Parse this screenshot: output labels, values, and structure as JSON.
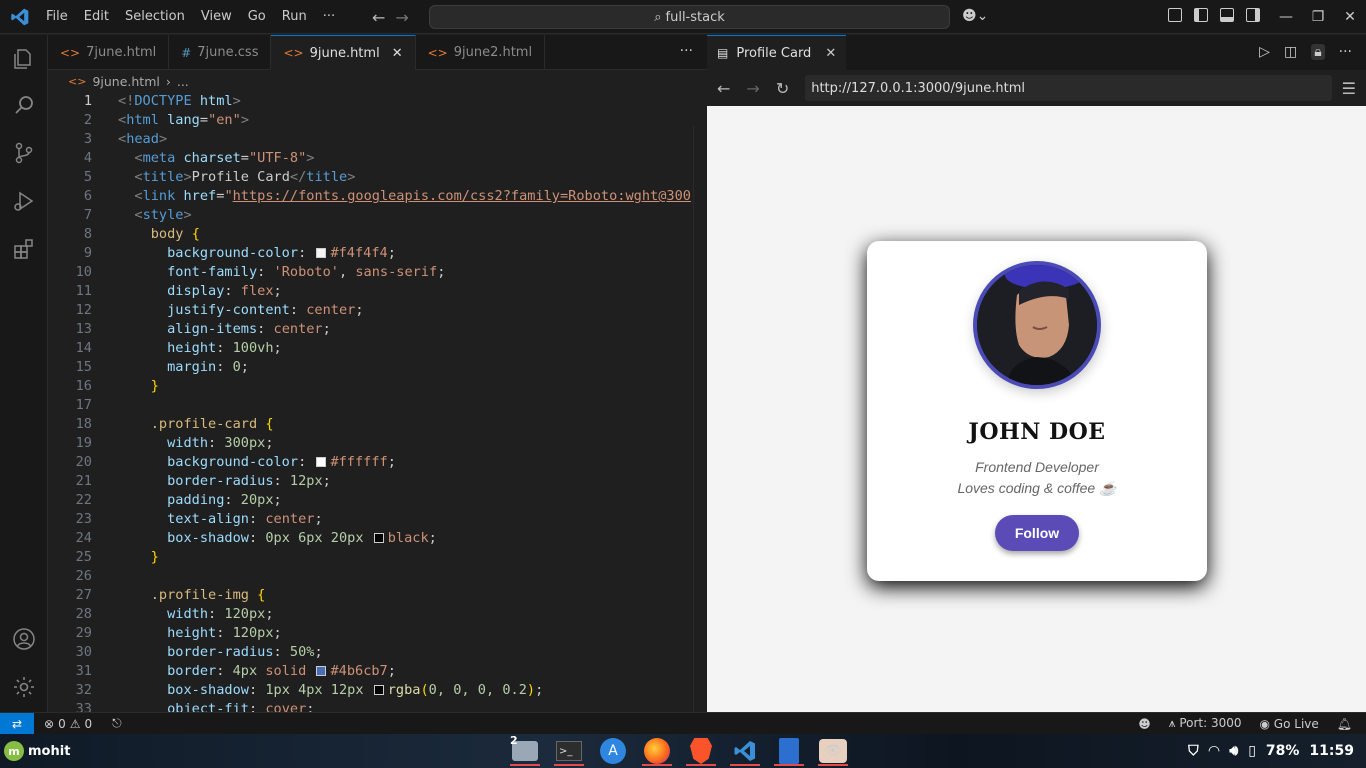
{
  "titlebar": {
    "menu": [
      "File",
      "Edit",
      "Selection",
      "View",
      "Go",
      "Run",
      "···"
    ],
    "search": "full-stack"
  },
  "editor": {
    "tabs": [
      {
        "label": "7june.html",
        "type": "html"
      },
      {
        "label": "7june.css",
        "type": "css"
      },
      {
        "label": "9june.html",
        "type": "html",
        "active": true
      },
      {
        "label": "9june2.html",
        "type": "html"
      }
    ],
    "breadcrumb": {
      "file": "9june.html",
      "rest": "..."
    },
    "lines": [
      {
        "n": "1",
        "html": "<span class='t-br'>&lt;!</span><span class='t-tag'>DOCTYPE</span> <span class='t-at'>html</span><span class='t-br'>&gt;</span>"
      },
      {
        "n": "2",
        "html": "<span class='t-br'>&lt;</span><span class='t-tag'>html</span> <span class='t-at'>lang</span>=<span class='t-st'>\"en\"</span><span class='t-br'>&gt;</span>"
      },
      {
        "n": "3",
        "html": "<span class='t-br'>&lt;</span><span class='t-tag'>head</span><span class='t-br'>&gt;</span>"
      },
      {
        "n": "4",
        "html": "  <span class='t-br'>&lt;</span><span class='t-tag'>meta</span> <span class='t-at'>charset</span>=<span class='t-st'>\"UTF-8\"</span><span class='t-br'>&gt;</span>"
      },
      {
        "n": "5",
        "html": "  <span class='t-br'>&lt;</span><span class='t-tag'>title</span><span class='t-br'>&gt;</span>Profile Card<span class='t-br'>&lt;/</span><span class='t-tag'>title</span><span class='t-br'>&gt;</span>"
      },
      {
        "n": "6",
        "html": "  <span class='t-br'>&lt;</span><span class='t-tag'>link</span> <span class='t-at'>href</span>=<span class='t-st'>\"</span><span class='t-url'>https://fonts.googleapis.com/css2?family=Roboto:wght@300</span>"
      },
      {
        "n": "7",
        "html": "  <span class='t-br'>&lt;</span><span class='t-tag'>style</span><span class='t-br'>&gt;</span>"
      },
      {
        "n": "8",
        "html": "    <span class='t-sel'>body</span> <span class='t-brace'>{</span>"
      },
      {
        "n": "9",
        "html": "      <span class='t-pr'>background-color</span>: <i class='sw' style='background:#f4f4f4'></i><span class='t-val'>#f4f4f4</span>;"
      },
      {
        "n": "10",
        "html": "      <span class='t-pr'>font-family</span>: <span class='t-st'>'Roboto'</span>, <span class='t-val'>sans-serif</span>;"
      },
      {
        "n": "11",
        "html": "      <span class='t-pr'>display</span>: <span class='t-val'>flex</span>;"
      },
      {
        "n": "12",
        "html": "      <span class='t-pr'>justify-content</span>: <span class='t-val'>center</span>;"
      },
      {
        "n": "13",
        "html": "      <span class='t-pr'>align-items</span>: <span class='t-val'>center</span>;"
      },
      {
        "n": "14",
        "html": "      <span class='t-pr'>height</span>: <span class='t-num'>100vh</span>;"
      },
      {
        "n": "15",
        "html": "      <span class='t-pr'>margin</span>: <span class='t-num'>0</span>;"
      },
      {
        "n": "16",
        "html": "    <span class='t-brace'>}</span>"
      },
      {
        "n": "17",
        "html": ""
      },
      {
        "n": "18",
        "html": "    <span class='t-sel'>.profile-card</span> <span class='t-brace'>{</span>"
      },
      {
        "n": "19",
        "html": "      <span class='t-pr'>width</span>: <span class='t-num'>300px</span>;"
      },
      {
        "n": "20",
        "html": "      <span class='t-pr'>background-color</span>: <i class='sw' style='background:#ffffff'></i><span class='t-val'>#ffffff</span>;"
      },
      {
        "n": "21",
        "html": "      <span class='t-pr'>border-radius</span>: <span class='t-num'>12px</span>;"
      },
      {
        "n": "22",
        "html": "      <span class='t-pr'>padding</span>: <span class='t-num'>20px</span>;"
      },
      {
        "n": "23",
        "html": "      <span class='t-pr'>text-align</span>: <span class='t-val'>center</span>;"
      },
      {
        "n": "24",
        "html": "      <span class='t-pr'>box-shadow</span>: <span class='t-num'>0px 6px 20px</span> <i class='sw' style='background:#000'></i><span class='t-val'>black</span>;"
      },
      {
        "n": "25",
        "html": "    <span class='t-brace'>}</span>"
      },
      {
        "n": "26",
        "html": ""
      },
      {
        "n": "27",
        "html": "    <span class='t-sel'>.profile-img</span> <span class='t-brace'>{</span>"
      },
      {
        "n": "28",
        "html": "      <span class='t-pr'>width</span>: <span class='t-num'>120px</span>;"
      },
      {
        "n": "29",
        "html": "      <span class='t-pr'>height</span>: <span class='t-num'>120px</span>;"
      },
      {
        "n": "30",
        "html": "      <span class='t-pr'>border-radius</span>: <span class='t-num'>50%</span>;"
      },
      {
        "n": "31",
        "html": "      <span class='t-pr'>border</span>: <span class='t-num'>4px</span> <span class='t-val'>solid</span> <i class='sw' style='background:#4b6cb7'></i><span class='t-val'>#4b6cb7</span>;"
      },
      {
        "n": "32",
        "html": "      <span class='t-pr'>box-shadow</span>: <span class='t-num'>1px 4px 12px</span> <i class='sw' style='background:#000'></i><span class='t-fn'>rgba</span><span class='t-brace'>(</span><span class='t-num'>0, 0, 0, 0.2</span><span class='t-brace'>)</span>;"
      },
      {
        "n": "33",
        "html": "      <span class='t-pr'>object-fit</span>: <span class='t-val'>cover</span>;"
      }
    ]
  },
  "preview": {
    "tab_title": "Profile Card",
    "url": "http://127.0.0.1:3000/9june.html",
    "card": {
      "name": "JOHN DOE",
      "role": "Frontend Developer",
      "bio": "Loves coding & coffee ☕",
      "button": "Follow",
      "accent": "#5a4bb7"
    }
  },
  "statusbar": {
    "problems": "0",
    "warnings": "0",
    "port": "Port: 3000",
    "golive": "Go Live"
  },
  "taskbar": {
    "user": "mohit",
    "badge": "2",
    "battery": "78%",
    "clock": "11:59"
  }
}
